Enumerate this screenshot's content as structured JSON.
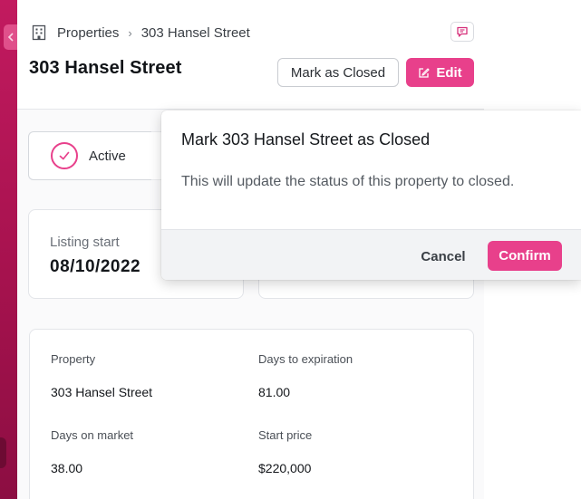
{
  "breadcrumb": {
    "icon": "building-icon",
    "parent": "Properties",
    "separator": "›",
    "current": "303 Hansel Street"
  },
  "header": {
    "title": "303 Hansel Street",
    "mark_closed_label": "Mark as Closed",
    "edit_label": "Edit",
    "comment_icon": "comment-icon"
  },
  "status": {
    "label": "Active",
    "icon": "check-icon"
  },
  "listing_card": {
    "label": "Listing start",
    "value": "08/10/2022"
  },
  "details": {
    "property_label": "Property",
    "property_value": "303 Hansel Street",
    "days_to_expiration_label": "Days to expiration",
    "days_to_expiration_value": "81.00",
    "days_on_market_label": "Days on market",
    "days_on_market_value": "38.00",
    "start_price_label": "Start price",
    "start_price_value": "$220,000"
  },
  "dialog": {
    "title": "Mark 303 Hansel Street as Closed",
    "body": "This will update the status of this property to closed.",
    "cancel_label": "Cancel",
    "confirm_label": "Confirm"
  },
  "colors": {
    "accent": "#e8408b",
    "sidebar": "#b0155a"
  }
}
